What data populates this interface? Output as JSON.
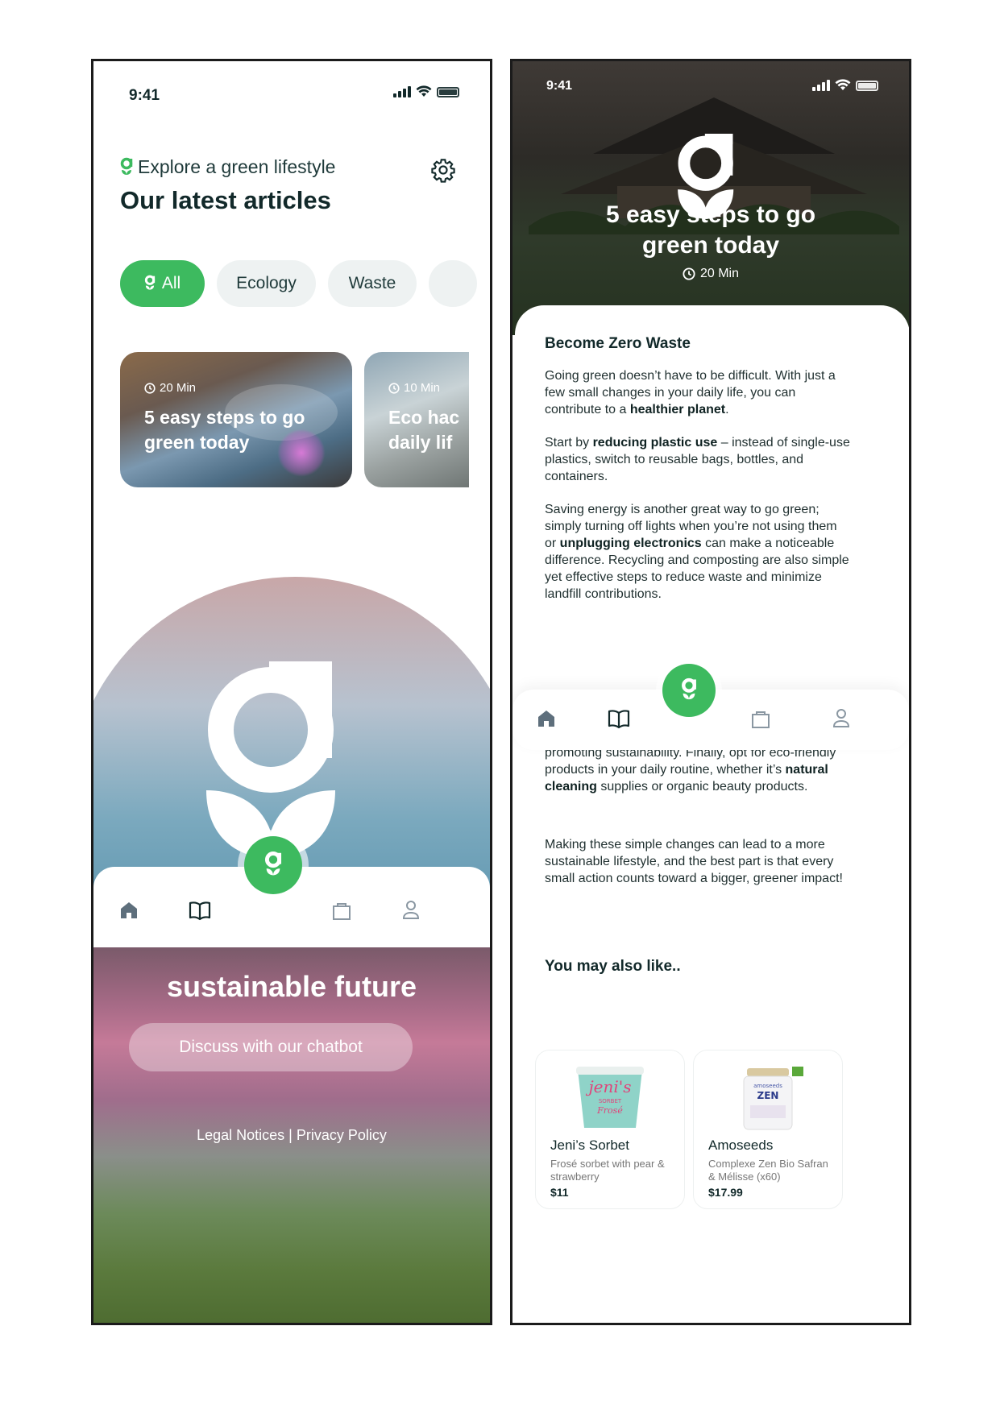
{
  "left": {
    "status": {
      "time": "9:41"
    },
    "header": {
      "subtitle": "Explore a green lifestyle",
      "title": "Our latest articles"
    },
    "chips": [
      "All",
      "Ecology",
      "Waste"
    ],
    "cards": [
      {
        "time": "20 Min",
        "title": "5 easy steps to go green today"
      },
      {
        "time": "10 Min",
        "title": "Eco hac daily lif"
      }
    ],
    "hero": {
      "tagline": "sustainable future"
    },
    "chat_button": "Discuss with our chatbot",
    "legal": {
      "notices": "Legal Notices",
      "sep": "|",
      "privacy": "Privacy Policy"
    }
  },
  "right": {
    "status": {
      "time": "9:41"
    },
    "hero": {
      "title": "5 easy steps to go green today",
      "time": "20 Min"
    },
    "section_title": "Become Zero Waste",
    "paragraphs": [
      {
        "before": "Going green doesn’t have to be difficult. With just a few small changes in your daily life, you can contribute to a ",
        "bold": "healthier planet",
        "after": "."
      },
      {
        "before": "Start by ",
        "bold": "reducing plastic use",
        "after": " – instead of single-use plastics, switch to reusable bags, bottles, and containers."
      },
      {
        "before": "Saving energy is another great way to go green; simply turning off lights when you’re not using them or ",
        "bold": "unplugging electronics",
        "after": " can make a noticeable difference. Recycling and composting are also simple yet effective steps to reduce waste and minimize landfill contributions."
      },
      {
        "before": "promoting sustainability. Finally, opt for eco-friendly products in your daily routine, whether it’s ",
        "bold": "natural cleaning",
        "after": " supplies or organic beauty products."
      },
      {
        "before": "Making these simple changes can lead to a more sustainable lifestyle, and the best part is that every small action counts toward a bigger, greener impact!",
        "bold": "",
        "after": ""
      }
    ],
    "also_like": "You may also like..",
    "products": [
      {
        "name": "Jeni’s Sorbet",
        "desc": "Frosé sorbet with pear & strawberry",
        "price": "$11",
        "label": "jeni's",
        "sublabel": "SORBET",
        "flavor": "Frosé"
      },
      {
        "name": "Amoseeds",
        "desc": "Complexe Zen Bio Safran & Mélisse (x60)",
        "price": "$17.99",
        "label": "ZEN",
        "sublabel": "amoseeds"
      }
    ]
  },
  "colors": {
    "brand_green": "#3dba5f",
    "text_dark": "#12292a",
    "chip_bg": "#eef2f2"
  },
  "icons": [
    "leaf-logo-icon",
    "gear-icon",
    "clock-icon",
    "home-icon",
    "book-icon",
    "bag-icon",
    "user-icon",
    "signal-icon",
    "wifi-icon",
    "battery-icon"
  ]
}
